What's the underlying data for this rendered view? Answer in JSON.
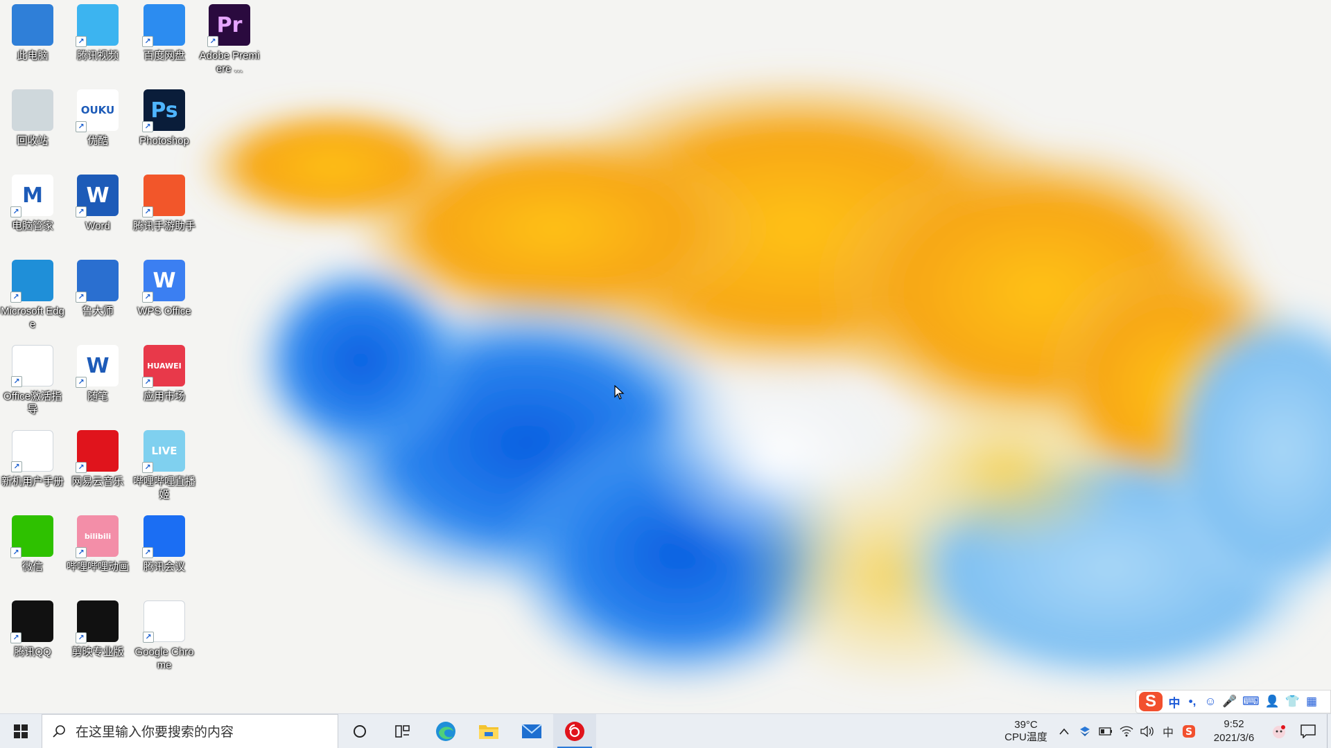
{
  "desktop": {
    "icons": [
      {
        "label": "此电脑",
        "icon": "computer-icon",
        "color": "#2f7fd8"
      },
      {
        "label": "腾讯视频",
        "icon": "tencent-video-icon",
        "color": "#3cb4f0"
      },
      {
        "label": "百度网盘",
        "icon": "baidu-netdisk-icon",
        "color": "#2c8cf0"
      },
      {
        "label": "Adobe Premiere ...",
        "icon": "premiere-icon",
        "color": "#2a0a3e",
        "glyph": "Pr"
      },
      {
        "label": "回收站",
        "icon": "recycle-bin-icon",
        "color": "#cfd8dc"
      },
      {
        "label": "优酷",
        "icon": "youku-icon",
        "color": "#ffffff",
        "glyph": "OUKU"
      },
      {
        "label": "Photoshop",
        "icon": "photoshop-icon",
        "color": "#0a1d3a",
        "glyph": "Ps"
      },
      {
        "label": "电脑管家",
        "icon": "pc-manager-icon",
        "color": "#ffffff",
        "glyph": "M"
      },
      {
        "label": "Word",
        "icon": "word-icon",
        "color": "#1d5bb8",
        "glyph": "W"
      },
      {
        "label": "腾讯手游助手",
        "icon": "tencent-game-assistant-icon",
        "color": "#f2562a"
      },
      {
        "label": "Microsoft Edge",
        "icon": "edge-icon",
        "color": "#1f8fd8"
      },
      {
        "label": "鲁大师",
        "icon": "ludashi-icon",
        "color": "#2a6fd0"
      },
      {
        "label": "WPS Office",
        "icon": "wps-office-icon",
        "color": "#3b7ff2",
        "glyph": "W"
      },
      {
        "label": "Office激活指导",
        "icon": "office-activation-icon",
        "color": "#ffffff"
      },
      {
        "label": "随笔",
        "icon": "notes-icon",
        "color": "#ffffff",
        "glyph": "W"
      },
      {
        "label": "应用市场",
        "icon": "huawei-appgallery-icon",
        "color": "#e8394a",
        "glyph": "HUAWEI"
      },
      {
        "label": "新机用户手册",
        "icon": "user-manual-icon",
        "color": "#ffffff"
      },
      {
        "label": "网易云音乐",
        "icon": "netease-music-icon",
        "color": "#e0141c"
      },
      {
        "label": "哔哩哔哩直播姬",
        "icon": "bilibili-live-icon",
        "color": "#7fd0ef",
        "glyph": "LIVE"
      },
      {
        "label": "微信",
        "icon": "wechat-icon",
        "color": "#2ec100"
      },
      {
        "label": "哔哩哔哩动画",
        "icon": "bilibili-icon",
        "color": "#f38ea8",
        "glyph": "bilibili"
      },
      {
        "label": "腾讯会议",
        "icon": "tencent-meeting-icon",
        "color": "#1b6ef3"
      },
      {
        "label": "腾讯QQ",
        "icon": "qq-icon",
        "color": "#111111"
      },
      {
        "label": "剪映专业版",
        "icon": "capcut-icon",
        "color": "#111111"
      },
      {
        "label": "Google Chrome",
        "icon": "chrome-icon",
        "color": "#ffffff"
      }
    ]
  },
  "ime": {
    "items": [
      {
        "icon": "sogou-s-icon",
        "text": "S"
      },
      {
        "icon": "chinese-mode-icon",
        "text": "中"
      },
      {
        "icon": "punctuation-icon",
        "text": "•,"
      },
      {
        "icon": "emoji-icon",
        "text": "☺"
      },
      {
        "icon": "mic-icon",
        "text": "🎤"
      },
      {
        "icon": "keyboard-icon",
        "text": "⌨"
      },
      {
        "icon": "user-icon",
        "text": "👤"
      },
      {
        "icon": "skin-icon",
        "text": "👕"
      },
      {
        "icon": "toolbox-icon",
        "text": "▦"
      }
    ]
  },
  "taskbar": {
    "search_placeholder": "在这里输入你要搜索的内容",
    "cpu_temp_value": "39°C",
    "cpu_temp_label": "CPU温度",
    "time": "9:52",
    "date": "2021/3/6",
    "input_mode": "中"
  }
}
